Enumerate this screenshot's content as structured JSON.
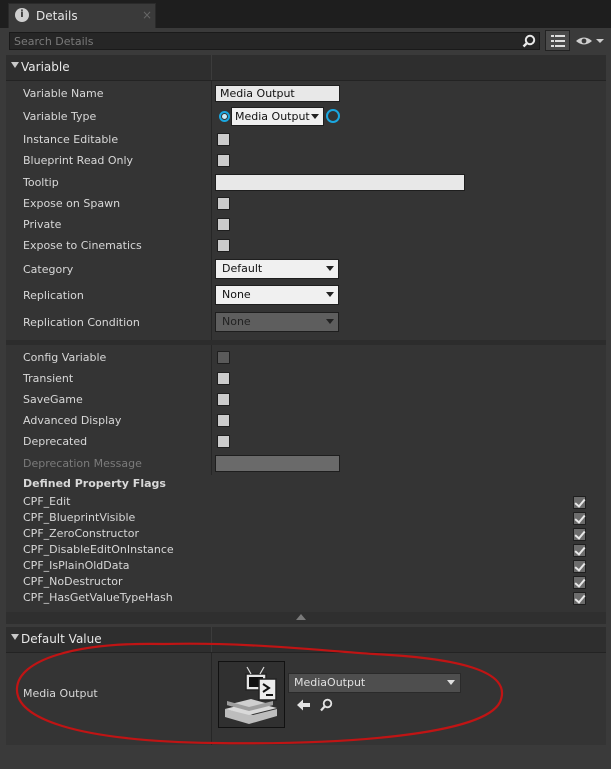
{
  "tab": {
    "title": "Details",
    "close": "×"
  },
  "search": {
    "placeholder": "Search Details",
    "value": ""
  },
  "variable_section": {
    "title": "Variable",
    "rows": {
      "variable_name": {
        "label": "Variable Name",
        "value": "Media Output"
      },
      "variable_type": {
        "label": "Variable Type",
        "value": "Media Output"
      },
      "instance_editable": {
        "label": "Instance Editable",
        "checked": false
      },
      "blueprint_read_only": {
        "label": "Blueprint Read Only",
        "checked": false
      },
      "tooltip": {
        "label": "Tooltip",
        "value": ""
      },
      "expose_on_spawn": {
        "label": "Expose on Spawn",
        "checked": false
      },
      "private": {
        "label": "Private",
        "checked": false
      },
      "expose_to_cinematics": {
        "label": "Expose to Cinematics",
        "checked": false
      },
      "category": {
        "label": "Category",
        "value": "Default"
      },
      "replication": {
        "label": "Replication",
        "value": "None"
      },
      "replication_condition": {
        "label": "Replication Condition",
        "value": "None"
      }
    }
  },
  "advanced": {
    "config_variable": "Config Variable",
    "transient": "Transient",
    "savegame": "SaveGame",
    "advanced_display": "Advanced Display",
    "deprecated": "Deprecated",
    "deprecation_message": "Deprecation Message",
    "flags_title": "Defined Property Flags",
    "flags": [
      "CPF_Edit",
      "CPF_BlueprintVisible",
      "CPF_ZeroConstructor",
      "CPF_DisableEditOnInstance",
      "CPF_IsPlainOldData",
      "CPF_NoDestructor",
      "CPF_HasGetValueTypeHash"
    ]
  },
  "default_value": {
    "title": "Default Value",
    "label": "Media Output",
    "asset": "MediaOutput"
  },
  "colors": {
    "pin_blue": "#1aa7e0",
    "annotation_red": "#c01414",
    "panel_bg": "#3a3a3a"
  },
  "icons": [
    "details-tab-icon",
    "search-icon",
    "view-options-icon",
    "eye-icon",
    "use-selected-arrow-icon",
    "browse-asset-icon"
  ]
}
